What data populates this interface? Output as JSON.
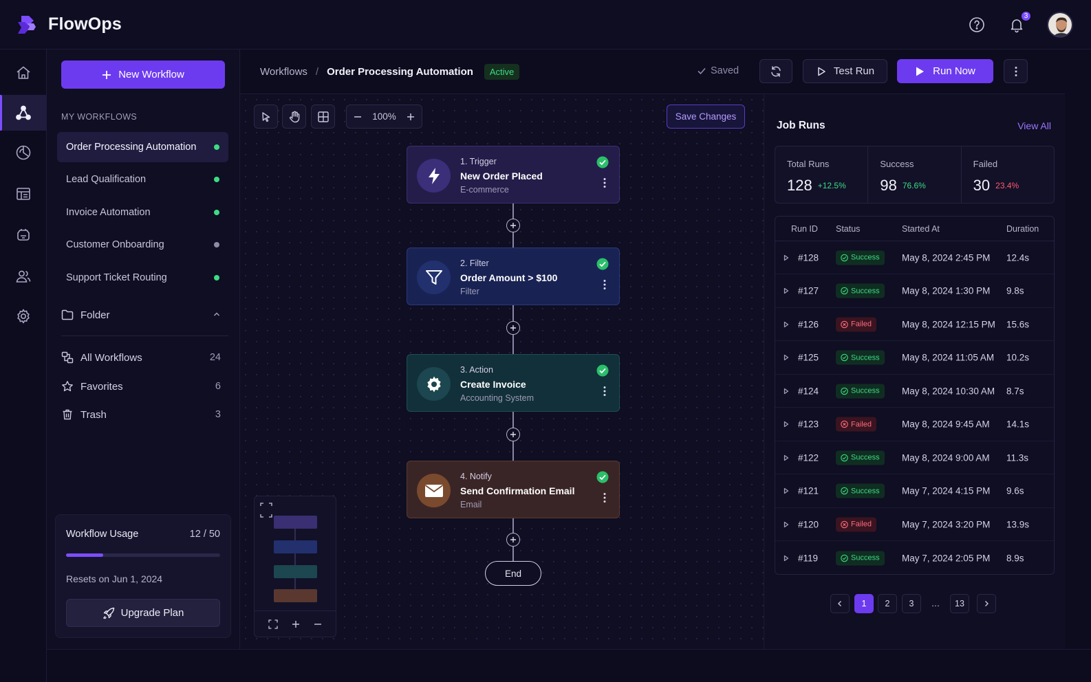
{
  "app": {
    "name": "FlowOps",
    "notification_count": "3"
  },
  "nav": {
    "items": [
      "home-icon",
      "workflows-icon",
      "analytics-icon",
      "table-icon",
      "integrations-icon",
      "users-icon",
      "settings-icon"
    ],
    "active": "workflows-icon"
  },
  "sidebar": {
    "new_workflow_label": "New Workflow",
    "section_label": "MY WORKFLOWS",
    "workflows": [
      {
        "label": "Order Processing Automation",
        "status": "active"
      },
      {
        "label": "Lead Qualification",
        "status": "active"
      },
      {
        "label": "Invoice Automation",
        "status": "active"
      },
      {
        "label": "Customer Onboarding",
        "status": "inactive"
      },
      {
        "label": "Support Ticket Routing",
        "status": "active"
      }
    ],
    "folder_label": "Folder",
    "library": [
      {
        "label": "All Workflows",
        "count": "24"
      },
      {
        "label": "Favorites",
        "count": "6"
      },
      {
        "label": "Trash",
        "count": "3"
      }
    ],
    "usage": {
      "title": "Workflow Usage",
      "count": "12 / 50",
      "fraction": 0.24,
      "reset": "Resets on Jun 1, 2024",
      "upgrade_label": "Upgrade Plan"
    }
  },
  "header": {
    "breadcrumb_root": "Workflows",
    "breadcrumb_sep": "/",
    "breadcrumb_current": "Order Processing Automation",
    "status": "Active",
    "saved_label": "Saved",
    "test_run_label": "Test Run",
    "run_now_label": "Run Now"
  },
  "canvas": {
    "zoom": "100%",
    "save_changes_label": "Save Changes",
    "end_label": "End",
    "nodes": [
      {
        "step": "1. Trigger",
        "title": "New Order Placed",
        "subtitle": "E-commerce",
        "kind": "trigger"
      },
      {
        "step": "2. Filter",
        "title": "Order Amount > $100",
        "subtitle": "Filter",
        "kind": "filter"
      },
      {
        "step": "3. Action",
        "title": "Create Invoice",
        "subtitle": "Accounting System",
        "kind": "action"
      },
      {
        "step": "4. Notify",
        "title": "Send Confirmation Email",
        "subtitle": "Email",
        "kind": "notify"
      }
    ]
  },
  "job_runs": {
    "title": "Job Runs",
    "view_all_label": "View All",
    "stats": [
      {
        "label": "Total Runs",
        "value": "128",
        "delta": "+12.5%",
        "color": "#3ddc84"
      },
      {
        "label": "Success",
        "value": "98",
        "delta": "76.6%",
        "color": "#3ddc84"
      },
      {
        "label": "Failed",
        "value": "30",
        "delta": "23.4%",
        "color": "#ff5a6e"
      }
    ],
    "columns": [
      "Run ID",
      "Status",
      "Started At",
      "Duration"
    ],
    "rows": [
      {
        "id": "#128",
        "status": "Success",
        "started": "May 8, 2024 2:45 PM",
        "duration": "12.4s"
      },
      {
        "id": "#127",
        "status": "Success",
        "started": "May 8, 2024 1:30 PM",
        "duration": "9.8s"
      },
      {
        "id": "#126",
        "status": "Failed",
        "started": "May 8, 2024 12:15 PM",
        "duration": "15.6s"
      },
      {
        "id": "#125",
        "status": "Success",
        "started": "May 8, 2024 11:05 AM",
        "duration": "10.2s"
      },
      {
        "id": "#124",
        "status": "Success",
        "started": "May 8, 2024 10:30 AM",
        "duration": "8.7s"
      },
      {
        "id": "#123",
        "status": "Failed",
        "started": "May 8, 2024 9:45 AM",
        "duration": "14.1s"
      },
      {
        "id": "#122",
        "status": "Success",
        "started": "May 8, 2024 9:00 AM",
        "duration": "11.3s"
      },
      {
        "id": "#121",
        "status": "Success",
        "started": "May 7, 2024 4:15 PM",
        "duration": "9.6s"
      },
      {
        "id": "#120",
        "status": "Failed",
        "started": "May 7, 2024 3:20 PM",
        "duration": "13.9s"
      },
      {
        "id": "#119",
        "status": "Success",
        "started": "May 7, 2024 2:05 PM",
        "duration": "8.9s"
      }
    ],
    "pagination": {
      "pages": [
        "1",
        "2",
        "3",
        "…",
        "13"
      ],
      "current": "1"
    }
  },
  "colors": {
    "accent": "#6d3bef",
    "success": "#3ddc84",
    "failed": "#ff5a6e",
    "inactive_dot": "#8e8ba8"
  }
}
